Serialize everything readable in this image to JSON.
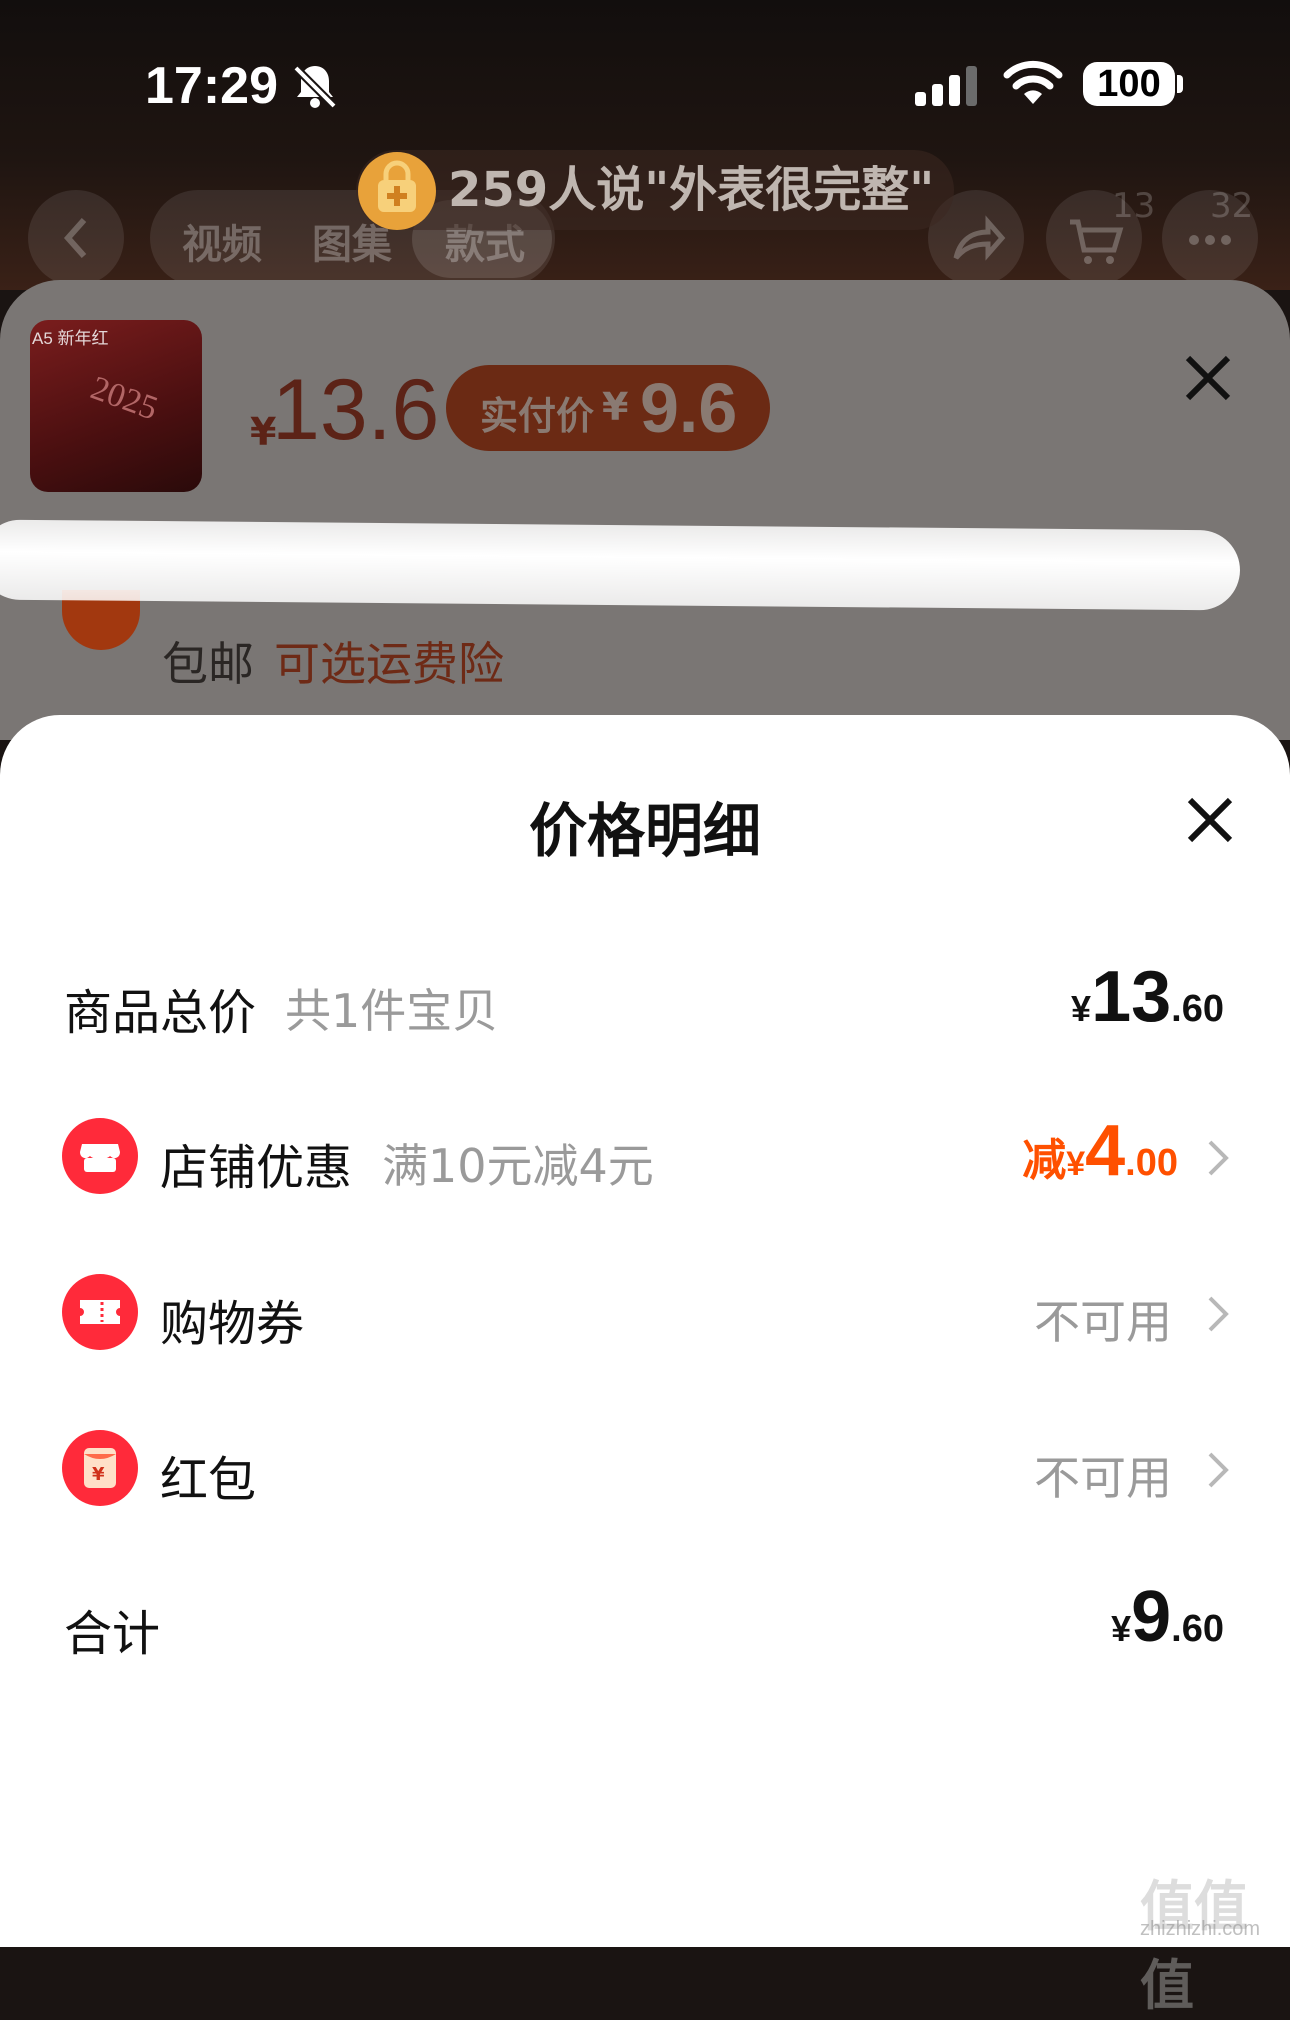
{
  "status_bar": {
    "time": "17:29",
    "battery": "100"
  },
  "nav": {
    "tabs": [
      "视频",
      "图集",
      "款式"
    ],
    "review_text": "259人说\"外表很完整\"",
    "cart_count": "13",
    "more_count": "32"
  },
  "product": {
    "thumb_tag": "A5 新年红",
    "thumb_year": "2025",
    "currency": "¥",
    "price": "13.6",
    "pay_label": "实付价",
    "pay_currency": "¥",
    "pay_price": "9.6",
    "shipping": "包邮",
    "shipping_option": "可选运费险"
  },
  "price_detail": {
    "title": "价格明细",
    "total": {
      "label": "商品总价",
      "sub": "共1件宝贝",
      "currency": "¥",
      "int": "13",
      "dec": ".60"
    },
    "store_discount": {
      "label": "店铺优惠",
      "sub": "满10元减4元",
      "prefix": "减",
      "currency": "¥",
      "int": "4",
      "dec": ".00"
    },
    "coupon": {
      "label": "购物券",
      "value": "不可用"
    },
    "red_packet": {
      "label": "红包",
      "value": "不可用",
      "icon_char": "¥"
    },
    "sum": {
      "label": "合计",
      "currency": "¥",
      "int": "9",
      "dec": ".60"
    }
  },
  "watermark": {
    "main": "值值值",
    "sub": "zhizhizhi.com"
  },
  "colors": {
    "accent_red": "#ff2a3a",
    "discount_orange": "#ff5000"
  }
}
